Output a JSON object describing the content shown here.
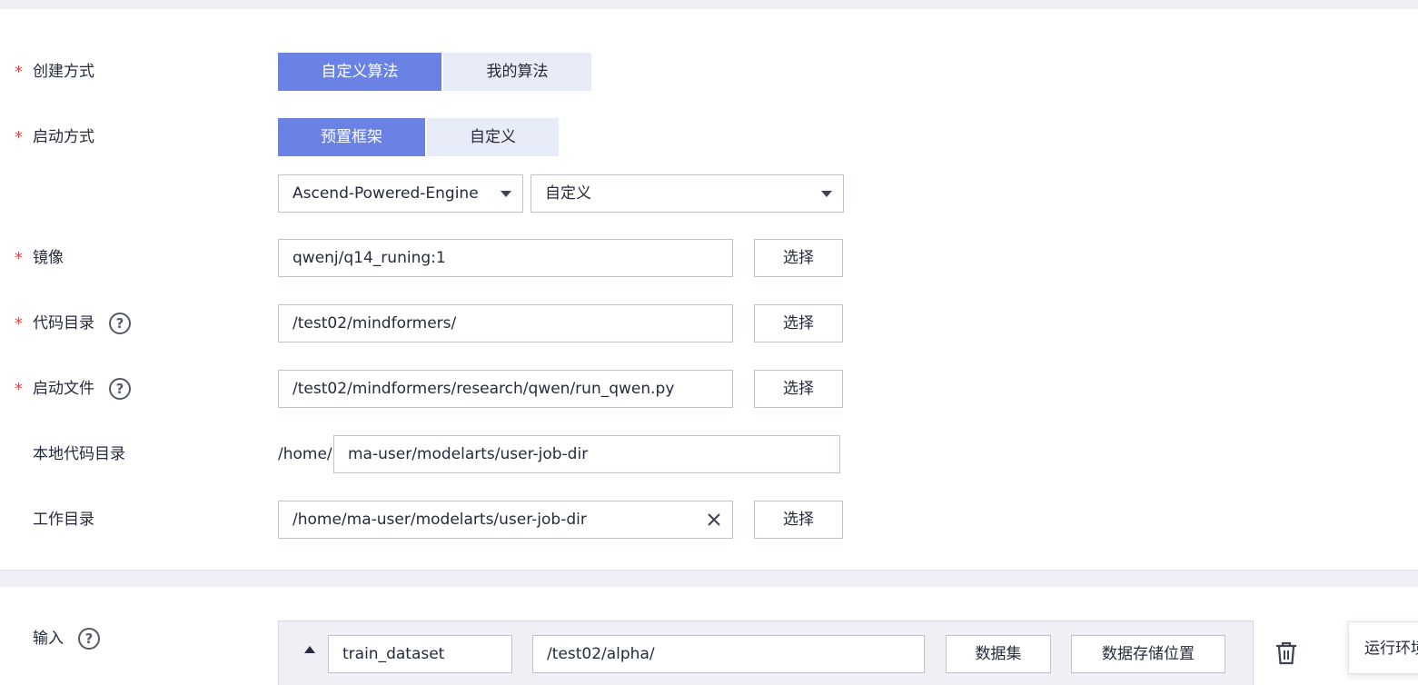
{
  "form": {
    "create_method": {
      "label": "创建方式",
      "required_mark": "*",
      "options": [
        "自定义算法",
        "我的算法"
      ],
      "selected": "自定义算法"
    },
    "start_method": {
      "label": "启动方式",
      "required_mark": "*",
      "options": [
        "预置框架",
        "自定义"
      ],
      "selected": "预置框架"
    },
    "engine": {
      "framework_value": "Ascend-Powered-Engine",
      "version_value": "自定义"
    },
    "image": {
      "label": "镜像",
      "required_mark": "*",
      "value": "qwenj/q14_runing:1",
      "button": "选择"
    },
    "code_dir": {
      "label": "代码目录",
      "required_mark": "*",
      "help_icon": "?",
      "value": "/test02/mindformers/",
      "button": "选择"
    },
    "boot_file": {
      "label": "启动文件",
      "required_mark": "*",
      "help_icon": "?",
      "value": "/test02/mindformers/research/qwen/run_qwen.py",
      "button": "选择"
    },
    "local_code_dir": {
      "label": "本地代码目录",
      "prefix": "/home/",
      "value": "ma-user/modelarts/user-job-dir"
    },
    "work_dir": {
      "label": "工作目录",
      "value": "/home/ma-user/modelarts/user-job-dir",
      "button": "选择"
    }
  },
  "input": {
    "label": "输入",
    "help_icon": "?",
    "name_value": "train_dataset",
    "path_value": "/test02/alpha/",
    "dataset_button": "数据集",
    "storage_button": "数据存储位置"
  },
  "tooltip": {
    "text": "运行环境"
  },
  "colors": {
    "accent": "#6b82e5",
    "inactive_segment": "#e8ecf8",
    "required": "#e54545",
    "page_bg": "#eef0f5"
  }
}
